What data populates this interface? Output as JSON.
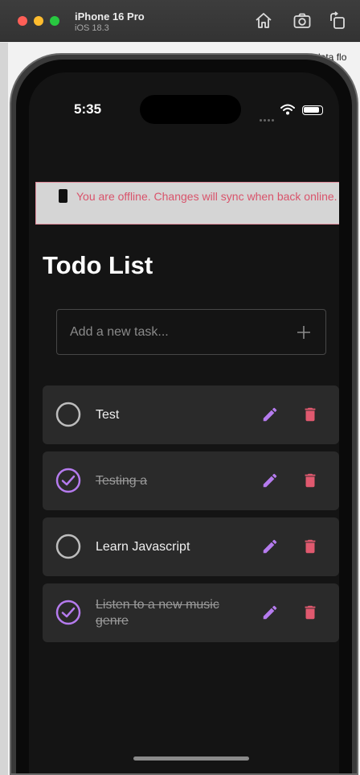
{
  "window": {
    "device_name": "iPhone 16 Pro",
    "os_version": "iOS 18.3"
  },
  "backdrop": {
    "peek_text": "data flo"
  },
  "status_bar": {
    "time": "5:35"
  },
  "offline_banner": {
    "icon": "phone-icon",
    "message": "You are offline. Changes will sync when back online."
  },
  "page": {
    "title": "Todo List"
  },
  "add_task": {
    "placeholder": "Add a new task...",
    "value": ""
  },
  "tasks": [
    {
      "label": "Test",
      "completed": false
    },
    {
      "label": "Testing a",
      "completed": true
    },
    {
      "label": "Learn Javascript",
      "completed": false
    },
    {
      "label": "Listen to a new music genre",
      "completed": true
    }
  ],
  "colors": {
    "accent": "#b57bee",
    "delete": "#e0596f",
    "offline_text": "#d9536b"
  }
}
